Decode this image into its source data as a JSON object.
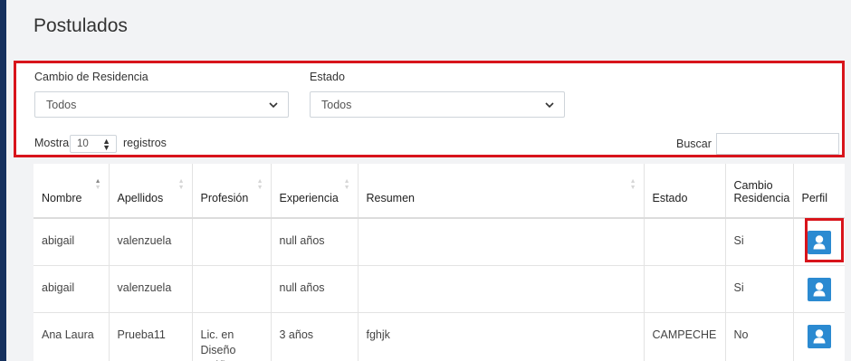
{
  "page": {
    "title": "Postulados"
  },
  "filters": {
    "residence_label": "Cambio de Residencia",
    "residence_value": "Todos",
    "state_label": "Estado",
    "state_value": "Todos"
  },
  "table_controls": {
    "show_label": "Mostrar",
    "length_value": "10",
    "records_label": "registros",
    "search_label": "Buscar",
    "search_value": ""
  },
  "table": {
    "headers": [
      "Nombre",
      "Apellidos",
      "Profesión",
      "Experiencia",
      "Resumen",
      "Estado",
      "Cambio Residencia",
      "Perfil"
    ],
    "rows": [
      {
        "nombre": "abigail",
        "apellidos": "valenzuela",
        "profesion": "",
        "experiencia": "null años",
        "resumen": "",
        "estado": "",
        "cambio": "Si",
        "perfil_icon": "user-icon"
      },
      {
        "nombre": "abigail",
        "apellidos": "valenzuela",
        "profesion": "",
        "experiencia": "null años",
        "resumen": "",
        "estado": "",
        "cambio": "Si",
        "perfil_icon": "user-icon"
      },
      {
        "nombre": "Ana Laura",
        "apellidos": "Prueba11",
        "profesion": "Lic. en Diseño Gráfico",
        "experiencia": "3 años",
        "resumen": "fghjk",
        "estado": "CAMPECHE",
        "cambio": "No",
        "perfil_icon": "user-icon"
      }
    ]
  },
  "colors": {
    "highlight": "#d8141b",
    "button": "#2b8ad1",
    "sidebar": "#16315e"
  }
}
